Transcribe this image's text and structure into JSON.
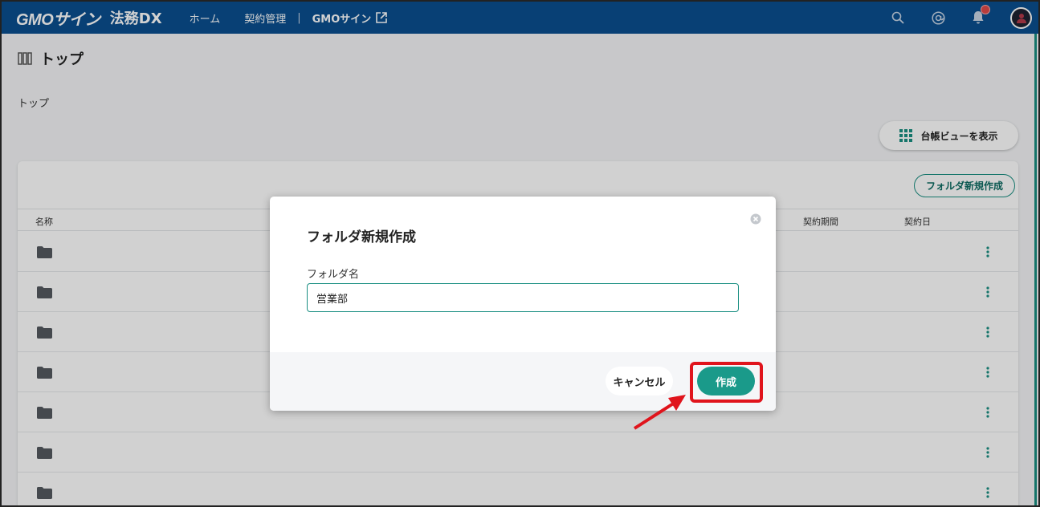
{
  "navbar": {
    "logo_main": "GMOサイン",
    "logo_sub": "法務DX",
    "links": [
      "ホーム",
      "契約管理"
    ],
    "separator": "|",
    "external_link": "GMOサイン",
    "icons": [
      "search-icon",
      "mention-icon",
      "bell-icon",
      "avatar"
    ]
  },
  "page": {
    "title": "トップ",
    "breadcrumb": "トップ",
    "ledger_view_button": "台帳ビューを表示"
  },
  "table": {
    "new_folder_button": "フォルダ新規作成",
    "columns": {
      "name": "名称",
      "period": "契約期間",
      "date": "契約日"
    },
    "row_count": 7
  },
  "modal": {
    "title": "フォルダ新規作成",
    "field_label": "フォルダ名",
    "field_value": "営業部",
    "cancel_label": "キャンセル",
    "create_label": "作成"
  },
  "colors": {
    "navbar": "#0a4f8f",
    "accent": "#1a9a8a",
    "highlight": "#e0141c"
  }
}
